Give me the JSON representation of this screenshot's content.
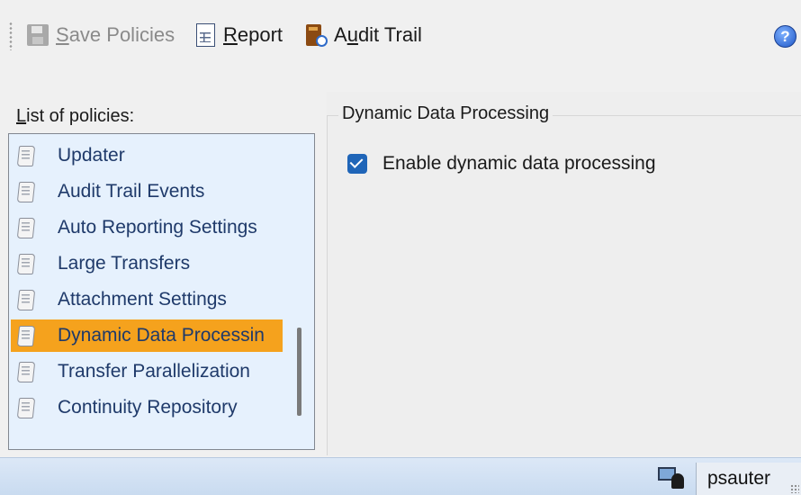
{
  "toolbar": {
    "save_label": "Save Policies",
    "save_mnemonic": "S",
    "save_rest": "ave Policies",
    "report_mnemonic": "R",
    "report_rest": "eport",
    "audit_pre": "A",
    "audit_mnemonic": "u",
    "audit_rest": "dit Trail",
    "help_symbol": "?",
    "icons": {
      "save": "floppy-disk-icon",
      "report": "report-document-icon",
      "audit": "audit-book-clock-icon",
      "help": "help-icon"
    }
  },
  "policies": {
    "label_mnemonic": "L",
    "label_rest": "ist of policies:",
    "items": [
      {
        "label": "Updater",
        "selected": false
      },
      {
        "label": "Audit Trail Events",
        "selected": false
      },
      {
        "label": "Auto Reporting Settings",
        "selected": false
      },
      {
        "label": "Large Transfers",
        "selected": false
      },
      {
        "label": "Attachment Settings",
        "selected": false
      },
      {
        "label": "Dynamic Data Processin",
        "selected": true
      },
      {
        "label": "Transfer Parallelization",
        "selected": false
      },
      {
        "label": "Continuity Repository",
        "selected": false
      }
    ],
    "item_icon": "policy-scroll-icon",
    "selected_color": "#f5a21d"
  },
  "detail": {
    "group_title": "Dynamic Data Processing",
    "checkbox_label": "Enable dynamic data processing",
    "checkbox_checked": true
  },
  "statusbar": {
    "user": "psauter",
    "icon": "remote-user-icon"
  }
}
